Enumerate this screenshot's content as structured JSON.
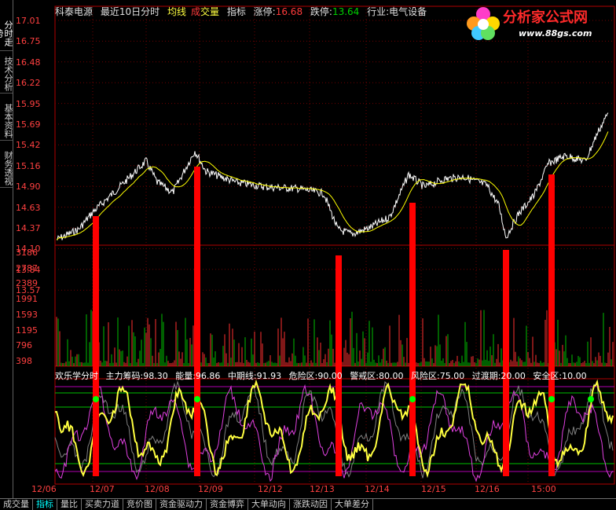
{
  "sidebar": {
    "tabs": [
      {
        "label": "分时走势"
      },
      {
        "label": "技术分析"
      },
      {
        "label": "基本资料"
      },
      {
        "label": "财务透视"
      }
    ]
  },
  "header": {
    "stock": "科泰电源",
    "period": "最近10日分时",
    "avg": "均线",
    "vol1": "成",
    "vol2": "交量",
    "indicator": "指标",
    "limit_up_label": "涨停:",
    "limit_up_value": "16.68",
    "limit_down_label": "跌停:",
    "limit_down_value": "13.64",
    "industry": "行业:电气设备"
  },
  "logo": {
    "title": "分析家公式网",
    "url": "www.88gs.com"
  },
  "price_axis": [
    "17.01",
    "16.75",
    "16.48",
    "16.22",
    "15.95",
    "15.69",
    "15.42",
    "15.16",
    "14.90",
    "14.63",
    "14.37",
    "14.10",
    "13.84",
    "13.57"
  ],
  "volume_axis": [
    "3186",
    "2787",
    "2389",
    "1991",
    "1593",
    "1195",
    "796",
    "398"
  ],
  "indicator_legend": {
    "name": "欢乐学分时",
    "items": [
      "主力筹码:98.30",
      "能量:96.86",
      "中期线:91.93",
      "危险区:90.00",
      "警戒区:80.00",
      "风险区:75.00",
      "过渡期:20.00",
      "安全区:10.00"
    ]
  },
  "x_axis": [
    "12/06",
    "12/07",
    "12/08",
    "12/09",
    "12/12",
    "12/13",
    "12/14",
    "12/15",
    "12/16",
    "15:00"
  ],
  "bottom_tabs": [
    {
      "label": "成交量",
      "active": false
    },
    {
      "label": "指标",
      "active": true
    },
    {
      "label": "量比",
      "active": false
    },
    {
      "label": "买卖力道",
      "active": false
    },
    {
      "label": "竞价图",
      "active": false
    },
    {
      "label": "资金驱动力",
      "active": false
    },
    {
      "label": "资金博弈",
      "active": false
    },
    {
      "label": "大单动向",
      "active": false
    },
    {
      "label": "涨跌动因",
      "active": false
    },
    {
      "label": "大单差分",
      "active": false
    }
  ],
  "colors": {
    "price_line": "#ffffff",
    "avg_line": "#ffff00",
    "signal_bar": "#ff0000",
    "volume_up": "#ff3030",
    "volume_down": "#00c000",
    "energy_line": "#ffff40",
    "chip_line": "#808080",
    "mid_line": "#e040e0"
  }
}
